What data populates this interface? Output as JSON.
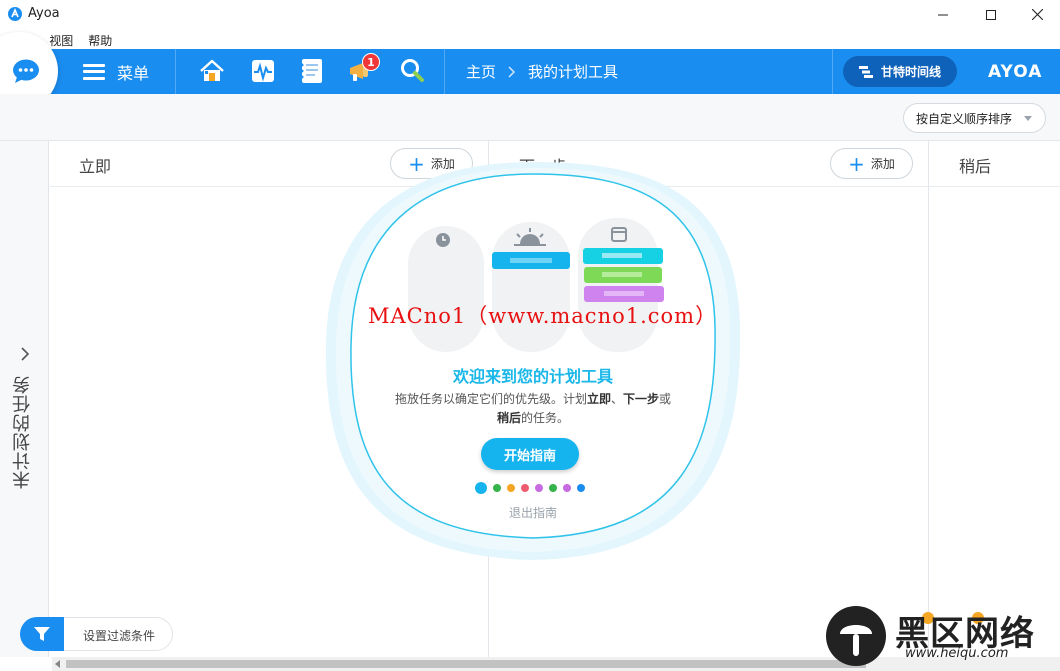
{
  "window": {
    "title": "Ayoa"
  },
  "menubar": {
    "items": [
      "Ayoa",
      "视图",
      "帮助"
    ]
  },
  "toolbar": {
    "menu_label": "菜单",
    "notifications_count": "1",
    "breadcrumb": [
      "主页",
      "我的计划工具"
    ],
    "gantt_label": "甘特时间线",
    "brand": "AYOA"
  },
  "sort": {
    "label": "按自定义顺序排序"
  },
  "sidebar": {
    "label": "未计划的任务"
  },
  "columns": [
    {
      "title": "立即",
      "add_label": "添加"
    },
    {
      "title": "下一步",
      "add_label": "添加"
    },
    {
      "title": "稍后"
    }
  ],
  "filter": {
    "label": "设置过滤条件"
  },
  "onboarding": {
    "title": "欢迎来到您的计划工具",
    "desc_prefix": "拖放任务以确定它们的优先级。计划",
    "desc_now": "立即",
    "desc_sep": "、",
    "desc_next": "下一步",
    "desc_or": "或",
    "desc_later": "稍后",
    "desc_suffix": "的任务。",
    "start_label": "开始指南",
    "exit_label": "退出指南",
    "dot_colors": [
      "#16b4ee",
      "#36b34a",
      "#f5a623",
      "#ef5b6e",
      "#c66be0",
      "#36b34a",
      "#c66be0",
      "#1a8df0"
    ]
  },
  "watermark": {
    "text": "MACno1（www.macno1.com）"
  },
  "site_logo": {
    "text": "黑区网络",
    "url": "www.heiqu.com"
  },
  "colors": {
    "accent": "#1a8df0",
    "accent_dark": "#0f62b9",
    "cyan": "#16b4ee"
  }
}
